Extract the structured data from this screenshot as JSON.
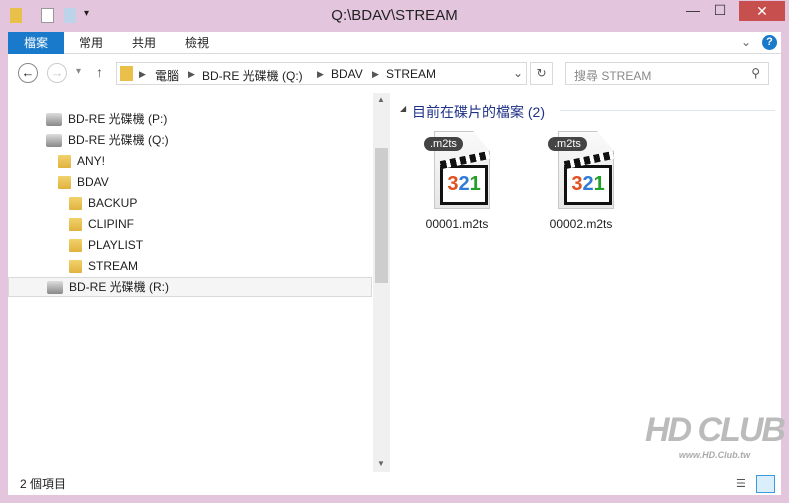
{
  "window": {
    "title": "Q:\\BDAV\\STREAM",
    "minimize": "—",
    "maximize": "☐",
    "close": "✕"
  },
  "ribbon": {
    "tabs": [
      "檔案",
      "常用",
      "共用",
      "檢視"
    ],
    "help": "?",
    "expand": "⌄"
  },
  "nav": {
    "back": "←",
    "forward": "→",
    "recent": "▾",
    "up": "↑",
    "breadcrumb": [
      "電腦",
      "BD-RE 光碟機 (Q:)",
      "BDAV",
      "STREAM"
    ],
    "refresh": "↻",
    "search_placeholder": "搜尋 STREAM"
  },
  "tree": [
    {
      "label": "BD-RE 光碟機 (P:)",
      "type": "drive",
      "level": 0
    },
    {
      "label": "BD-RE 光碟機 (Q:)",
      "type": "drive",
      "level": 0
    },
    {
      "label": "ANY!",
      "type": "folder",
      "level": 1
    },
    {
      "label": "BDAV",
      "type": "folder",
      "level": 1
    },
    {
      "label": "BACKUP",
      "type": "folder",
      "level": 2
    },
    {
      "label": "CLIPINF",
      "type": "folder",
      "level": 2
    },
    {
      "label": "PLAYLIST",
      "type": "folder",
      "level": 2
    },
    {
      "label": "STREAM",
      "type": "folder",
      "level": 2
    },
    {
      "label": "BD-RE 光碟機 (R:)",
      "type": "drive",
      "level": 0,
      "selected": true
    }
  ],
  "content": {
    "group_title": "目前在碟片的檔案 (2)",
    "files": [
      {
        "name": "00001.m2ts",
        "badge": ".m2ts"
      },
      {
        "name": "00002.m2ts",
        "badge": ".m2ts"
      }
    ]
  },
  "status": {
    "count": "2 個項目"
  },
  "watermark": {
    "text": "HD CLUB",
    "url": "www.HD.Club.tw"
  }
}
